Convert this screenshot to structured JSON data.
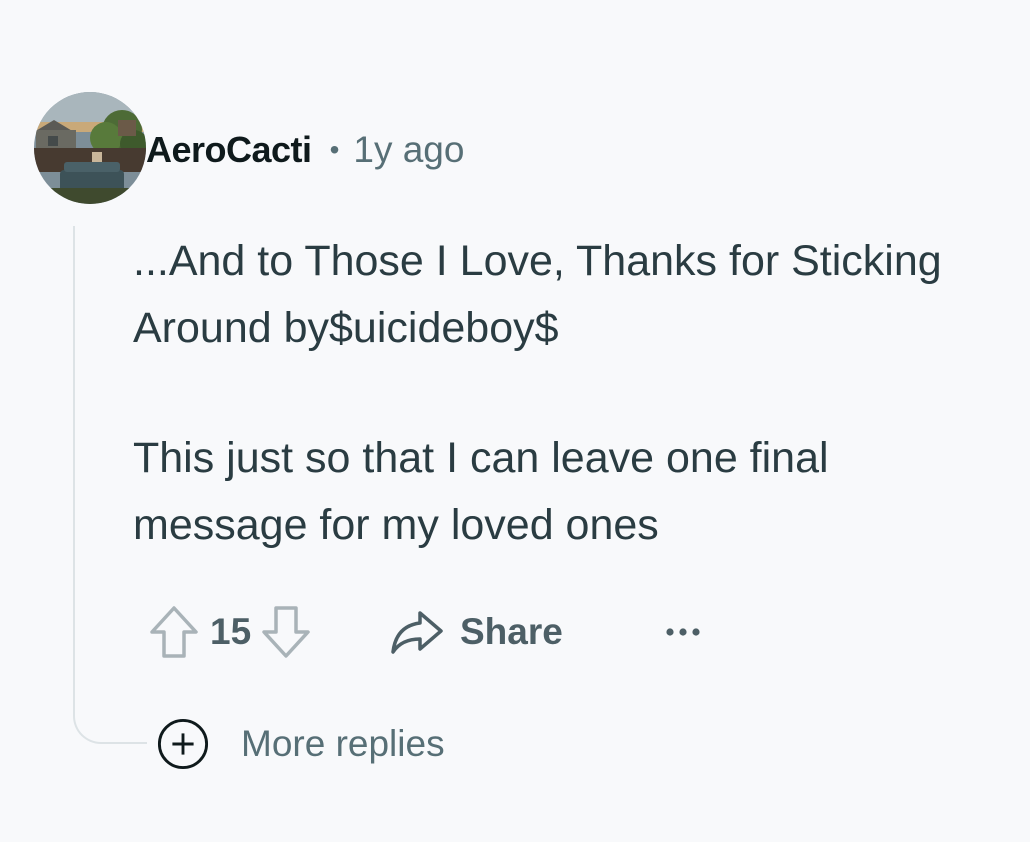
{
  "comment": {
    "author": "AeroCacti",
    "separator": "•",
    "timestamp": "1y ago",
    "avatar_icon": "backyard-photo-avatar",
    "body": [
      "...And to Those I Love, Thanks for Sticking Around by$uicideboy$",
      "This just so that I can leave one final message for my loved ones"
    ]
  },
  "actions": {
    "score": "15",
    "share_label": "Share",
    "upvote_icon": "arrow-up-icon",
    "downvote_icon": "arrow-down-icon",
    "share_icon": "share-arrow-icon",
    "more_icon": "ellipsis-icon"
  },
  "replies": {
    "more_label": "More replies",
    "icon": "plus-circle-icon"
  },
  "colors": {
    "background": "#f8f9fb",
    "username": "#0f1a1c",
    "body_text": "#2a3c42",
    "muted": "#576f76",
    "thread_line": "#dde3e6"
  }
}
